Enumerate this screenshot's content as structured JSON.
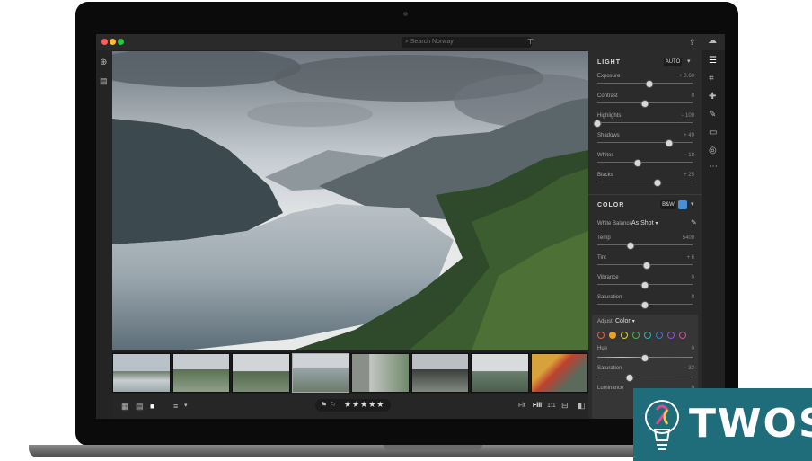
{
  "app": {
    "search_placeholder": "Search Norway"
  },
  "panel": {
    "light": {
      "title": "LIGHT",
      "auto_label": "AUTO",
      "sliders": [
        {
          "label": "Exposure",
          "value": "+ 0.60",
          "level": 0.55
        },
        {
          "label": "Contrast",
          "value": "0",
          "level": 0.5
        },
        {
          "label": "Highlights",
          "value": "− 100",
          "level": 0.0
        },
        {
          "label": "Shadows",
          "value": "+ 49",
          "level": 0.75
        },
        {
          "label": "Whites",
          "value": "− 18",
          "level": 0.42
        },
        {
          "label": "Blacks",
          "value": "+ 25",
          "level": 0.63
        }
      ]
    },
    "color": {
      "title": "COLOR",
      "bw_label": "B&W",
      "white_balance_label": "White Balance",
      "white_balance_value": "As Shot",
      "sliders": [
        {
          "label": "Temp",
          "value": "5400",
          "level": 0.35
        },
        {
          "label": "Tint",
          "value": "+ 6",
          "level": 0.52
        },
        {
          "label": "Vibrance",
          "value": "0",
          "level": 0.5
        },
        {
          "label": "Saturation",
          "value": "0",
          "level": 0.5
        }
      ],
      "adjust_label": "Adjust",
      "adjust_value": "Color",
      "hue_label": "Hue",
      "hue_value": "0",
      "hue_level": 0.5,
      "saturation_label": "Saturation",
      "saturation_value": "− 32",
      "saturation_level": 0.34,
      "luminance_label": "Luminance",
      "luminance_value": "0",
      "swatches": [
        "#e0633c",
        "#f0a020",
        "#e6d23a",
        "#4cb24c",
        "#2fb5b0",
        "#3f78d8",
        "#8a55d8",
        "#d04fa8"
      ]
    }
  },
  "bottombar": {
    "rating": "★★★★★",
    "fit_label": "Fit",
    "fill_label": "Fill",
    "ratio_label": "1:1"
  },
  "watermark": {
    "brand": "TWOS",
    "colors": {
      "background": "#1f6c7a",
      "text": "#ffffff"
    }
  }
}
